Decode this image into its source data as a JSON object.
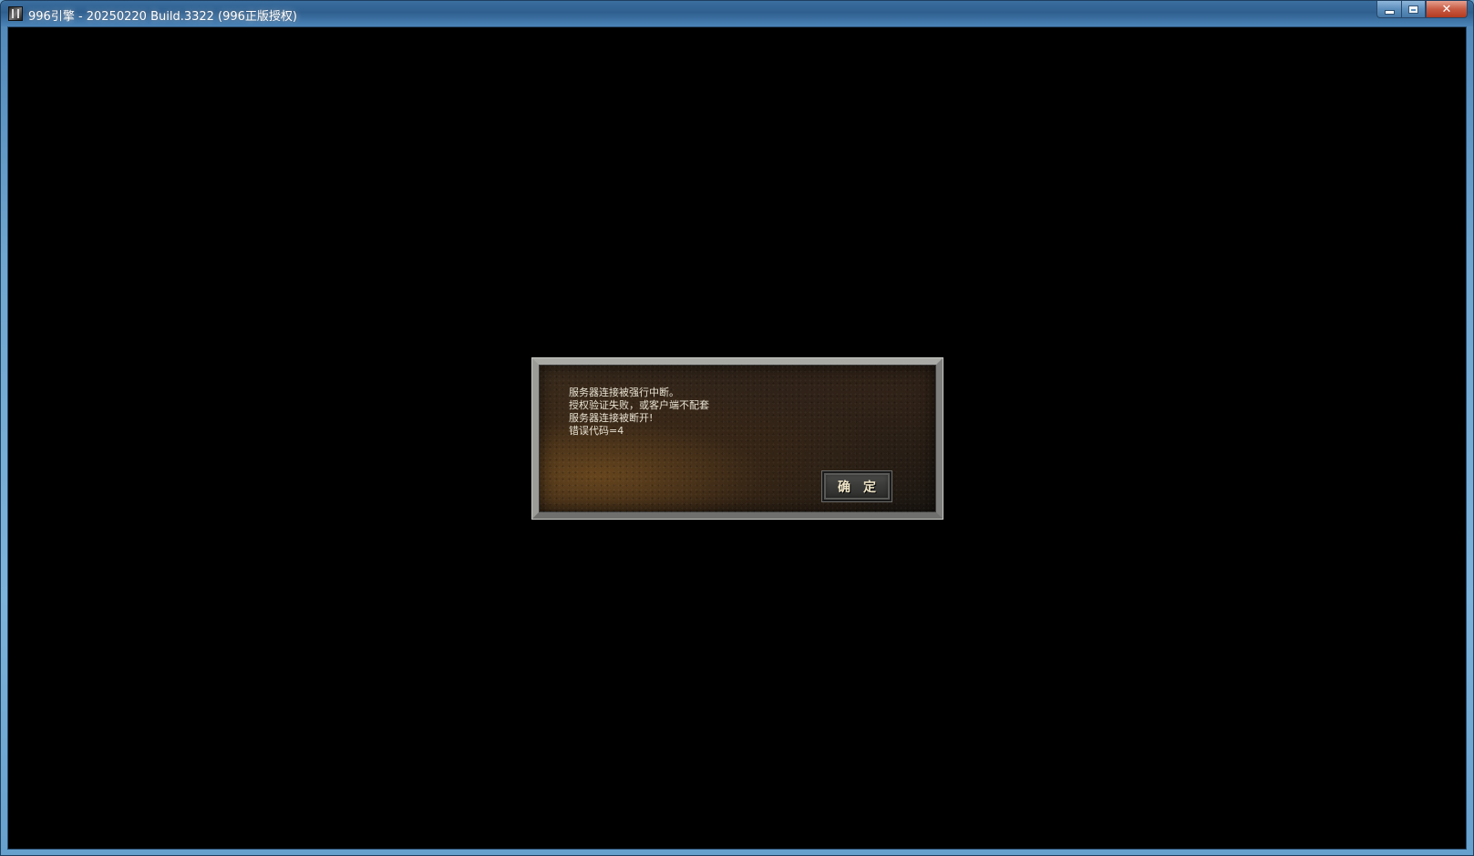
{
  "window": {
    "title": "996引擎 - 20250220 Build.3322 (996正版授权)",
    "icon": "dragon-app-icon",
    "caption_buttons": {
      "minimize": "minimize-icon",
      "maximize": "maximize-icon",
      "close": "✕"
    }
  },
  "dialog": {
    "lines": [
      "服务器连接被强行中断。",
      "授权验证失败，或客户端不配套",
      "服务器连接被断开!",
      "错误代码=4"
    ],
    "ok_label": "确定"
  },
  "colors": {
    "client_background": "#000000",
    "dialog_text": "#e8e2d2",
    "titlebar": "#3a6fa0"
  }
}
